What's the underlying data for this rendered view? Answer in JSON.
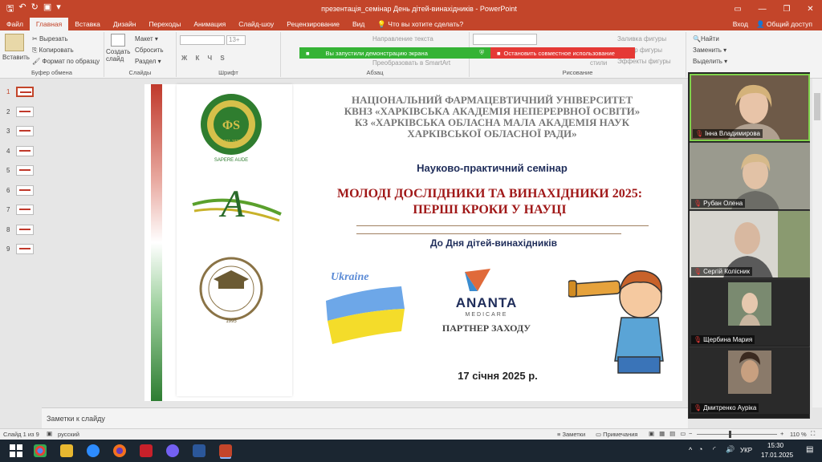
{
  "window": {
    "title": "презентація_семінар День дітей-винахідників - PowerPoint"
  },
  "menu": {
    "tabs": [
      "Файл",
      "Главная",
      "Вставка",
      "Дизайн",
      "Переходы",
      "Анимация",
      "Слайд-шоу",
      "Рецензирование",
      "Вид"
    ],
    "active": "Главная",
    "tellme": "Что вы хотите сделать?",
    "signin": "Вход",
    "share": "Общий доступ"
  },
  "ribbon": {
    "paste": "Вставить",
    "cut": "Вырезать",
    "copy": "Копировать",
    "format": "Формат по образцу",
    "clipboard": "Буфер обмена",
    "new_slide": "Создать слайд",
    "layout": "Макет",
    "reset": "Сбросить",
    "section": "Раздел",
    "slides": "Слайды",
    "font_size": "13+",
    "font": "Шрифт",
    "paragraph": "Абзац",
    "text_dir": "Направление текста",
    "smartart": "Преобразовать в SmartArt",
    "styles": "стили",
    "drawing": "Рисование",
    "fill": "Заливка фигуры",
    "outline": "Контур фигуры",
    "effects": "Эффекты фигуры",
    "find": "Найти",
    "replace": "Заменить",
    "select": "Выделить"
  },
  "banner": {
    "demo": "Вы запустили демонстрацию экрана",
    "stop": "Остановить совместное использование"
  },
  "thumbnails": [
    "1",
    "2",
    "3",
    "4",
    "5",
    "6",
    "7",
    "8",
    "9"
  ],
  "slide": {
    "title_lines": [
      "НАЦІОНАЛЬНИЙ ФАРМАЦЕВТИЧНИЙ УНІВЕРСИТЕТ",
      "КВНЗ «ХАРКІВСЬКА АКАДЕМІЯ НЕПЕРЕРВНОЇ ОСВІТИ»",
      "КЗ «ХАРКІВСЬКА ОБЛАСНА МАЛА АКАДЕМІЯ НАУК",
      "ХАРКІВСЬКОЇ ОБЛАСНОЇ РАДИ»"
    ],
    "seminar": "Науково-практичний семінар",
    "main_title_1": "МОЛОДІ ДОСЛІДНИКИ ТА ВИНАХІДНИКИ 2025:",
    "main_title_2": "ПЕРШІ КРОКИ У НАУЦІ",
    "subtitle": "До Дня дітей-винахідників",
    "partner_logo": "ANANTA",
    "partner_logo_sub": "MEDICARE",
    "partner_label": "ПАРТНЕР ЗАХОДУ",
    "ukraine": "Ukraine",
    "date": "17 січня 2025 р."
  },
  "logos": {
    "logo1_year_top": "1805",
    "logo1_motto": "SAPERE AUDE",
    "logo1_years": "1921-1925",
    "logo3_year": "1995"
  },
  "notes_placeholder": "Заметки к слайду",
  "statusbar": {
    "slide_info": "Слайд 1 из 9",
    "language": "русский",
    "notes": "Заметки",
    "comments": "Примечания",
    "zoom": "110 %"
  },
  "participants": [
    "Інна Владимирова",
    "Рубан Олена",
    "Сергій Колісник",
    "Щербина Мария",
    "Дмитренко Ауріка"
  ],
  "taskbar": {
    "lang": "УКР",
    "time": "15:30",
    "date": "17.01.2025"
  },
  "colors": {
    "accent": "#c3452a",
    "dark_red": "#a01818",
    "navy": "#1f2d5a"
  }
}
